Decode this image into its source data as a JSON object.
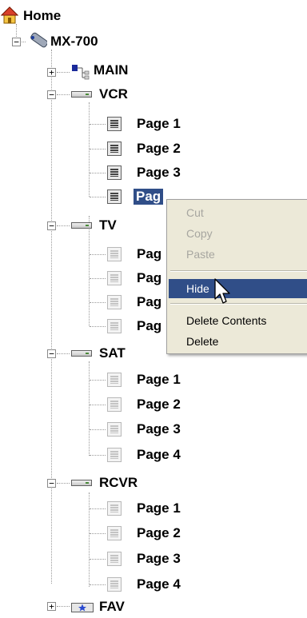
{
  "tree": {
    "root": {
      "label": "Home",
      "icon": "home-icon"
    },
    "remote": {
      "label": "MX-700",
      "icon": "remote-control-icon"
    },
    "main": {
      "label": "MAIN",
      "icon": "hierarchy-icon"
    },
    "vcr": {
      "label": "VCR",
      "icon": "device-icon",
      "pages": [
        "Page 1",
        "Page 2",
        "Page 3",
        "Page 4"
      ]
    },
    "tv": {
      "label": "TV",
      "icon": "device-icon",
      "pages": [
        "Pag",
        "Pag",
        "Pag",
        "Pag"
      ]
    },
    "sat": {
      "label": "SAT",
      "icon": "device-icon",
      "pages": [
        "Page 1",
        "Page 2",
        "Page 3",
        "Page 4"
      ]
    },
    "rcvr": {
      "label": "RCVR",
      "icon": "device-icon",
      "pages": [
        "Page 1",
        "Page 2",
        "Page 3",
        "Page 4"
      ]
    },
    "fav": {
      "label": "FAV",
      "icon": "favorites-icon"
    },
    "selected_label": "Pag"
  },
  "context_menu": {
    "cut": "Cut",
    "copy": "Copy",
    "paste": "Paste",
    "hide": "Hide",
    "delete_contents": "Delete Contents",
    "delete": "Delete"
  },
  "colors": {
    "selection": "#304e88",
    "menu_bg": "#ece9d8",
    "disabled_text": "#a7a6a0"
  }
}
